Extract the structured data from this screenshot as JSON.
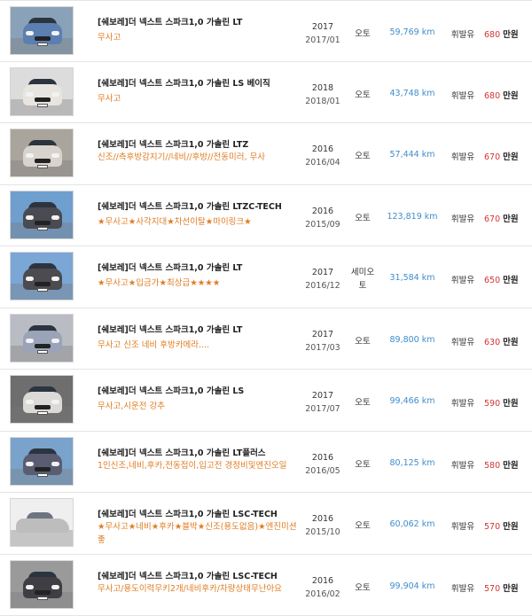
{
  "listings": [
    {
      "title": "[쉐보레]더 넥스트 스파크1,0 가솔린 LT",
      "subtitle": "무사고",
      "year": "2017",
      "reg_date": "2017/01",
      "transmission": "오토",
      "mileage": "59,769 km",
      "fuel": "휘발유",
      "price": "680",
      "price_unit": "만원",
      "thumb": {
        "car_color": "#5b7fb0",
        "bg": "#8aa2b8",
        "style": "hatch"
      }
    },
    {
      "title": "[쉐보레]더 넥스트 스파크1,0 가솔린 LS 베이직",
      "subtitle": "무사고",
      "year": "2018",
      "reg_date": "2018/01",
      "transmission": "오토",
      "mileage": "43,748 km",
      "fuel": "휘발유",
      "price": "680",
      "price_unit": "만원",
      "thumb": {
        "car_color": "#e8e4df",
        "bg": "#dcdcdc",
        "style": "hatch"
      }
    },
    {
      "title": "[쉐보레]더 넥스트 스파크1,0 가솔린 LTZ",
      "subtitle": "신조//측후방감지기//네비//후방//전동미러, 무사",
      "year": "2016",
      "reg_date": "2016/04",
      "transmission": "오토",
      "mileage": "57,444 km",
      "fuel": "휘발유",
      "price": "670",
      "price_unit": "만원",
      "thumb": {
        "car_color": "#d8d3cc",
        "bg": "#a9a49c",
        "style": "hatch"
      }
    },
    {
      "title": "[쉐보레]더 넥스트 스파크1,0 가솔린 LTZC-TECH",
      "subtitle": "★무사고★사각지대★차선이탈★마이링크★",
      "year": "2016",
      "reg_date": "2015/09",
      "transmission": "오토",
      "mileage": "123,819 km",
      "fuel": "휘발유",
      "price": "670",
      "price_unit": "만원",
      "thumb": {
        "car_color": "#4a4a52",
        "bg": "#6f9fcf",
        "style": "hatch"
      }
    },
    {
      "title": "[쉐보레]더 넥스트 스파크1,0 가솔린 LT",
      "subtitle": "★무사고★입금가★최상급★★★★",
      "year": "2017",
      "reg_date": "2016/12",
      "transmission": "세미오토",
      "mileage": "31,584 km",
      "fuel": "휘발유",
      "price": "650",
      "price_unit": "만원",
      "thumb": {
        "car_color": "#4b4b50",
        "bg": "#7aa7d6",
        "style": "hatch"
      }
    },
    {
      "title": "[쉐보레]더 넥스트 스파크1,0 가솔린 LT",
      "subtitle": "무사고 신조 네비 후방카메라....",
      "year": "2017",
      "reg_date": "2017/03",
      "transmission": "오토",
      "mileage": "89,800 km",
      "fuel": "휘발유",
      "price": "630",
      "price_unit": "만원",
      "thumb": {
        "car_color": "#9aa3b8",
        "bg": "#b9bcc2",
        "style": "hatch"
      }
    },
    {
      "title": "[쉐보레]더 넥스트 스파크1,0 가솔린 LS",
      "subtitle": "무사고,시운전 강추",
      "year": "2017",
      "reg_date": "2017/07",
      "transmission": "오토",
      "mileage": "99,466 km",
      "fuel": "휘발유",
      "price": "590",
      "price_unit": "만원",
      "thumb": {
        "car_color": "#dcdad6",
        "bg": "#6e6e6e",
        "style": "hatch"
      }
    },
    {
      "title": "[쉐보레]더 넥스트 스파크1,0 가솔린 LT플러스",
      "subtitle": "1인신조,네비,후카,전동접이,입고전 경정비및엔진오일",
      "year": "2016",
      "reg_date": "2016/05",
      "transmission": "오토",
      "mileage": "80,125 km",
      "fuel": "휘발유",
      "price": "580",
      "price_unit": "만원",
      "thumb": {
        "car_color": "#5a5d72",
        "bg": "#7aa3cc",
        "style": "hatch"
      }
    },
    {
      "title": "[쉐보레]더 넥스트 스파크1,0 가솔린 LSC-TECH",
      "subtitle": "★무사고★네비★후카★블박★신조(용도없음)★엔진미션좋",
      "year": "2016",
      "reg_date": "2015/10",
      "transmission": "오토",
      "mileage": "60,062 km",
      "fuel": "휘발유",
      "price": "570",
      "price_unit": "만원",
      "thumb": {
        "car_color": "#bdbdbd",
        "bg": "#efefef",
        "style": "sedan"
      }
    },
    {
      "title": "[쉐보레]더 넥스트 스파크1,0 가솔린 LSC-TECH",
      "subtitle": "무사고/용도이력무키2개/네비후카/차량상태무난아요",
      "year": "2016",
      "reg_date": "2016/02",
      "transmission": "오토",
      "mileage": "99,904 km",
      "fuel": "휘발유",
      "price": "570",
      "price_unit": "만원",
      "thumb": {
        "car_color": "#3f3e44",
        "bg": "#9a9a9a",
        "style": "hatch"
      }
    }
  ]
}
